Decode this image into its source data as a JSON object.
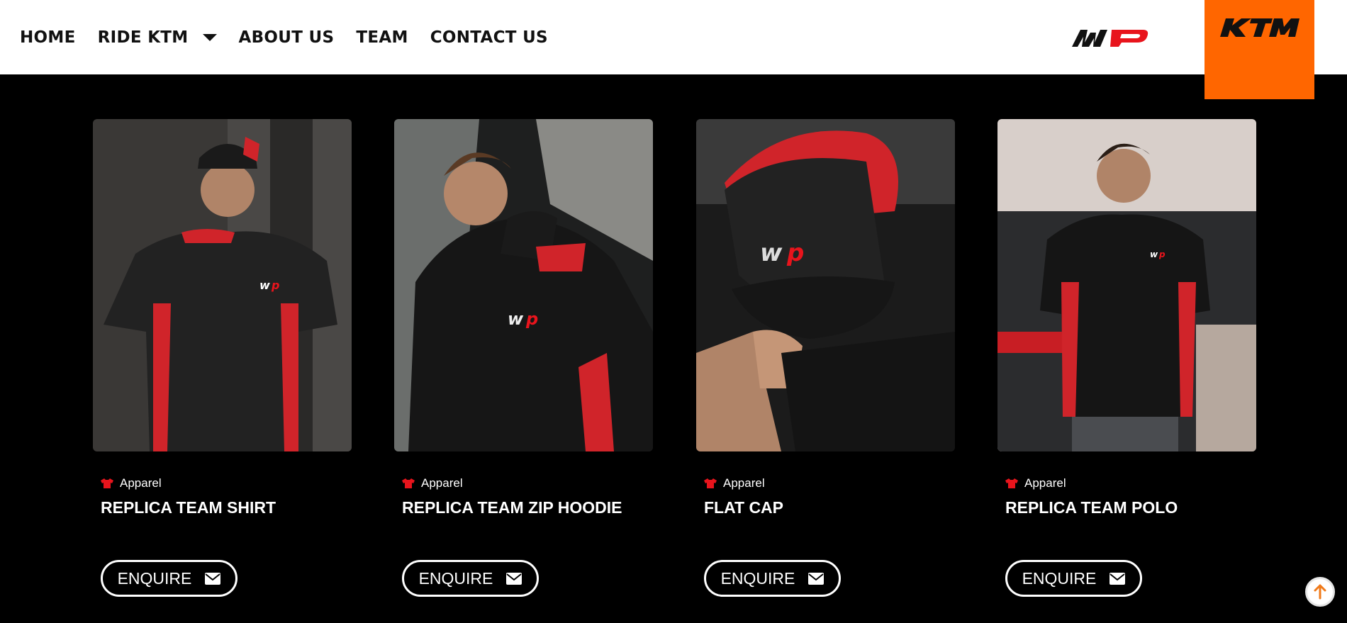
{
  "nav": {
    "items": [
      {
        "label": "HOME"
      },
      {
        "label": "RIDE KTM",
        "has_dropdown": true
      },
      {
        "label": "ABOUT US"
      },
      {
        "label": "TEAM"
      },
      {
        "label": "CONTACT US"
      }
    ]
  },
  "brand": {
    "wp_logo_text": "WP",
    "ktm_logo_text": "KTM",
    "ktm_color": "#ff6600",
    "accent_red": "#e8141c"
  },
  "products": [
    {
      "category": "Apparel",
      "title": "REPLICA TEAM SHIRT",
      "button": "ENQUIRE",
      "category_icon": "tshirt-icon",
      "button_icon": "envelope-icon"
    },
    {
      "category": "Apparel",
      "title": "REPLICA TEAM ZIP HOODIE",
      "button": "ENQUIRE",
      "category_icon": "tshirt-icon",
      "button_icon": "envelope-icon"
    },
    {
      "category": "Apparel",
      "title": "FLAT CAP",
      "button": "ENQUIRE",
      "category_icon": "tshirt-icon",
      "button_icon": "envelope-icon"
    },
    {
      "category": "Apparel",
      "title": "REPLICA TEAM POLO",
      "button": "ENQUIRE",
      "category_icon": "tshirt-icon",
      "button_icon": "envelope-icon"
    }
  ],
  "scroll_top_icon": "arrow-up-icon"
}
